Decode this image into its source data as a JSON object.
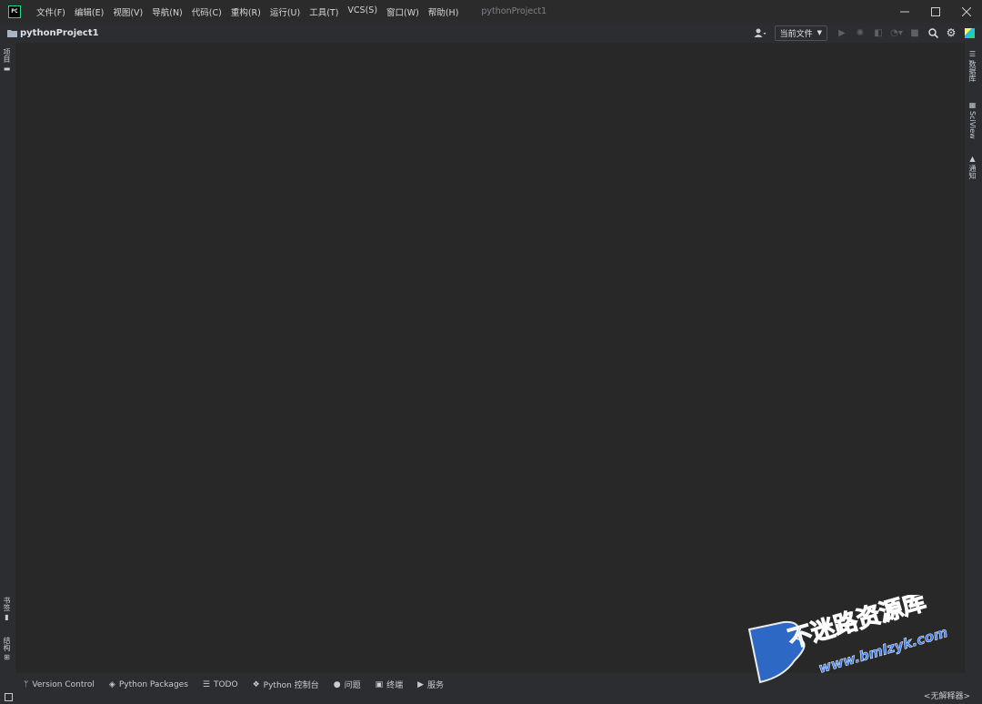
{
  "app": {
    "logo_text": "PC",
    "window_title": "pythonProject1"
  },
  "menu": [
    "文件(F)",
    "编辑(E)",
    "视图(V)",
    "导航(N)",
    "代码(C)",
    "重构(R)",
    "运行(U)",
    "工具(T)",
    "VCS(S)",
    "窗口(W)",
    "帮助(H)"
  ],
  "toolbar": {
    "project_name": "pythonProject1",
    "run_config": "当前文件"
  },
  "left_stripe": {
    "project": "项目",
    "bookmarks": "书签",
    "structure": "结构"
  },
  "right_stripe": {
    "database": "数据库",
    "sciview": "SciView",
    "notifications": "通知"
  },
  "bottom_tabs": {
    "version_control": "Version Control",
    "python_packages": "Python Packages",
    "todo": "TODO",
    "python_console": "Python 控制台",
    "problems": "问题",
    "terminal": "终端",
    "services": "服务"
  },
  "status": {
    "interpreter": "<无解释器>"
  },
  "watermark": {
    "brand": "不迷路资源库",
    "url": "www.bmlzyk.com"
  }
}
